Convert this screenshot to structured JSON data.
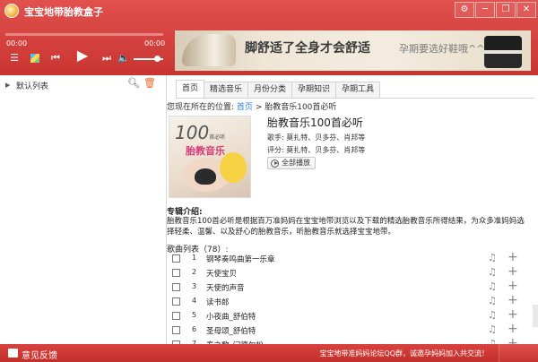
{
  "app": {
    "title": "宝宝地带胎教盒子",
    "window_buttons": [
      "⚙",
      "─",
      "❐",
      "✕"
    ]
  },
  "player": {
    "current_time": "00:00",
    "total_time": "00:00",
    "progress": 0,
    "volume": 0.8
  },
  "banner": {
    "headline": "脚舒适了全身才会舒适",
    "tagline": "孕期要选好鞋哦^^"
  },
  "sidebar": {
    "list_label": "默认列表"
  },
  "tabs": [
    "首页",
    "精选音乐",
    "月份分类",
    "孕期知识",
    "孕期工具"
  ],
  "active_tab": 0,
  "breadcrumb": {
    "prefix": "您现在所在的位置:",
    "home": "首页",
    "separator": ">",
    "current": "胎教音乐100首必听"
  },
  "album": {
    "cover_text_number": "100",
    "cover_text_small": "首必听",
    "cover_title": "胎教音乐",
    "title": "胎教音乐100首必听",
    "artists_label": "歌手:",
    "artists": "莫扎特、贝多芬、肖邦等",
    "rating_label": "评分:",
    "rating": "莫扎特、贝多芬、肖邦等",
    "play_all": "全部播放"
  },
  "intro": {
    "heading": "专辑介绍:",
    "text": "胎教音乐100首必听是根据百万准妈妈在宝宝地带浏览以及下载的精选胎教音乐所得结果，为众多准妈妈选择轻柔、温馨、以及舒心的胎教音乐，听胎教音乐就选择宝宝地带。"
  },
  "song_list": {
    "label": "歌曲列表（78）:",
    "songs": [
      {
        "num": "1",
        "name": "钢琴奏鸣曲第一乐章"
      },
      {
        "num": "2",
        "name": "天使宝贝"
      },
      {
        "num": "3",
        "name": "天使的声音"
      },
      {
        "num": "4",
        "name": "读书郎"
      },
      {
        "num": "5",
        "name": "小夜曲_舒伯特"
      },
      {
        "num": "6",
        "name": "圣母颂_舒伯特"
      },
      {
        "num": "7",
        "name": "春之歌_门德尔松"
      }
    ]
  },
  "footer": {
    "feedback": "意见反馈",
    "message": "宝宝地带准妈妈论坛QQ群，诚邀孕妈妈加入共交流！"
  },
  "colors": {
    "brand_red": "#d13c38",
    "link_blue": "#2d7fd6"
  }
}
